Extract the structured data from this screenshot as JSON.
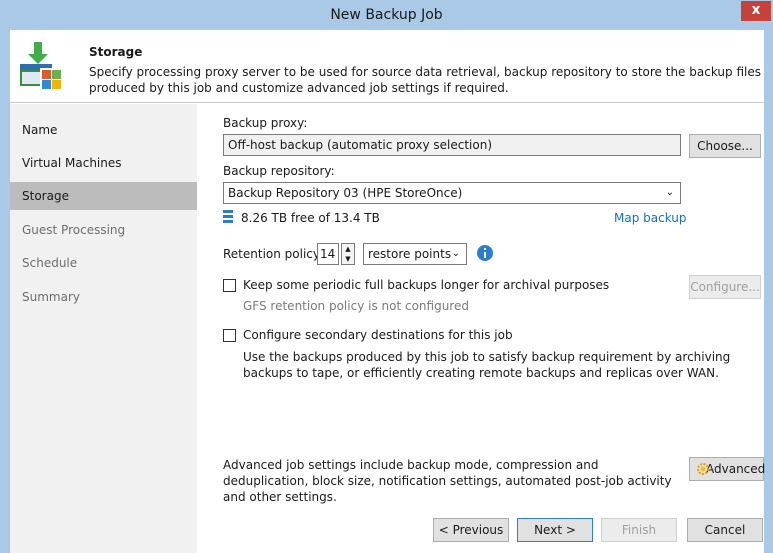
{
  "window": {
    "title": "New Backup Job",
    "close": "x"
  },
  "header": {
    "title": "Storage",
    "description": "Specify processing proxy server to be used for source data retrieval, backup repository to store the backup files produced by this job and customize advanced job settings if required.",
    "icon": "storage-wizard-icon"
  },
  "sidebar": {
    "items": [
      {
        "label": "Name",
        "state": "normal"
      },
      {
        "label": "Virtual Machines",
        "state": "normal"
      },
      {
        "label": "Storage",
        "state": "active"
      },
      {
        "label": "Guest Processing",
        "state": "disabled"
      },
      {
        "label": "Schedule",
        "state": "disabled"
      },
      {
        "label": "Summary",
        "state": "disabled"
      }
    ]
  },
  "proxy": {
    "label": "Backup proxy:",
    "value": "Off-host backup (automatic proxy selection)",
    "choose_label": "Choose..."
  },
  "repository": {
    "label": "Backup repository:",
    "value": "Backup Repository 03 (HPE StoreOnce)",
    "free_space": "8.26 TB free of 13.4 TB",
    "map_label": "Map backup"
  },
  "retention": {
    "label": "Retention policy:",
    "value": "14",
    "unit": "restore points"
  },
  "gfs": {
    "checkbox_label": "Keep some periodic full backups longer for archival purposes",
    "configure_label": "Configure...",
    "status": "GFS retention policy is not configured"
  },
  "secondary": {
    "checkbox_label": "Configure secondary destinations for this job",
    "description": "Use the backups produced by this job to satisfy backup requirement by archiving backups to tape, or efficiently creating remote backups and replicas over WAN."
  },
  "advanced": {
    "description": "Advanced job settings include backup mode, compression and deduplication, block size, notification settings, automated post-job activity and other settings.",
    "button_label": "Advanced"
  },
  "footer": {
    "previous": "< Previous",
    "next": "Next >",
    "finish": "Finish",
    "cancel": "Cancel"
  },
  "colors": {
    "titlebar": "#a9c9e6",
    "close": "#c7413b",
    "link": "#1570c4",
    "active_nav": "#bcbcbc"
  }
}
